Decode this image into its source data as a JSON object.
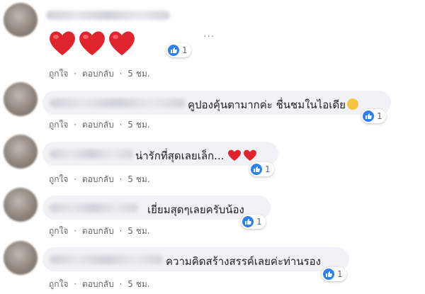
{
  "ui": {
    "like_color": "#2e80f0",
    "bubble_color": "#f0f2f5",
    "heart_color": "#e0242d"
  },
  "actions": {
    "like": "ถูกใจ",
    "reply": "ตอบกลับ",
    "separator": "·",
    "time": "5 ชม."
  },
  "more_options": "...",
  "comments": [
    {
      "text": "",
      "reaction_count": "1"
    },
    {
      "text": "คูปองคุ้นตามากค่ะ ชื่นชมในไอเดีย",
      "reaction_count": "1"
    },
    {
      "text": "น่ารักที่สุดเลยเล็ก...",
      "reaction_count": "1"
    },
    {
      "text": "เยี่ยมสุดๆเลยครับน้อง",
      "reaction_count": "1"
    },
    {
      "text": "ความคิดสร้างสรรค์เลยค่ะท่านรอง",
      "reaction_count": "1"
    }
  ]
}
